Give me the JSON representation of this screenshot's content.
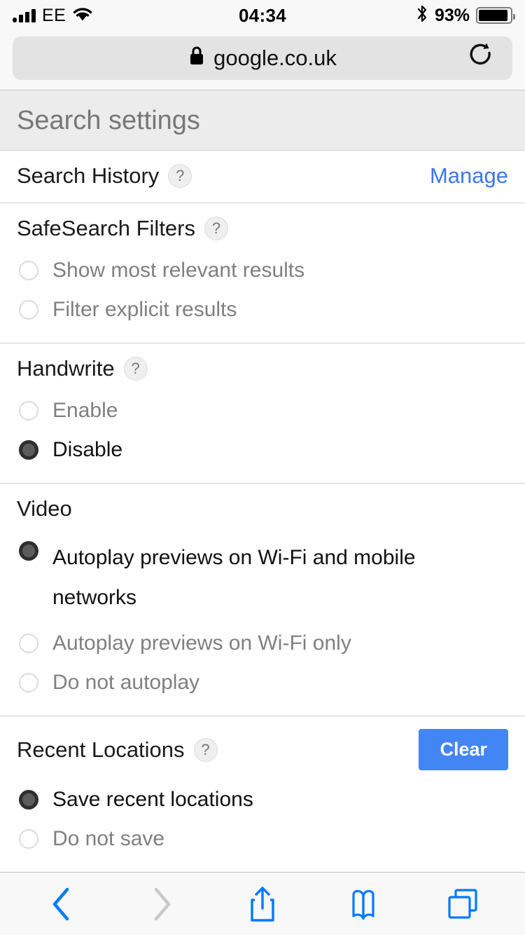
{
  "status_bar": {
    "carrier": "EE",
    "time": "04:34",
    "battery_percent": "93%",
    "signal_icon": "signal-bars-icon",
    "wifi_icon": "wifi-icon",
    "bluetooth_icon": "bluetooth-icon",
    "battery_icon": "battery-icon"
  },
  "browser": {
    "url": "google.co.uk",
    "lock_icon": "lock-icon",
    "reload_icon": "reload-icon",
    "toolbar": {
      "back_icon": "back-chevron-icon",
      "forward_icon": "forward-chevron-icon",
      "share_icon": "share-icon",
      "bookmarks_icon": "bookmarks-book-icon",
      "tabs_icon": "tabs-icon"
    }
  },
  "page": {
    "banner_title": "Search settings",
    "help_glyph": "?",
    "sections": [
      {
        "title": "Search History",
        "has_help": true,
        "action_label": "Manage",
        "action_type": "link",
        "options": []
      },
      {
        "title": "SafeSearch Filters",
        "has_help": true,
        "options": [
          {
            "label": "Show most relevant results",
            "selected": false
          },
          {
            "label": "Filter explicit results",
            "selected": false
          }
        ]
      },
      {
        "title": "Handwrite",
        "has_help": true,
        "options": [
          {
            "label": "Enable",
            "selected": false
          },
          {
            "label": "Disable",
            "selected": true
          }
        ]
      },
      {
        "title": "Video",
        "has_help": false,
        "options": [
          {
            "label": "Autoplay previews on Wi-Fi and mobile networks",
            "selected": true,
            "wraps": true
          },
          {
            "label": "Autoplay previews on Wi-Fi only",
            "selected": false
          },
          {
            "label": "Do not autoplay",
            "selected": false
          }
        ]
      },
      {
        "title": "Recent Locations",
        "has_help": true,
        "action_label": "Clear",
        "action_type": "button",
        "options": [
          {
            "label": "Save recent locations",
            "selected": true
          },
          {
            "label": "Do not save",
            "selected": false
          }
        ]
      }
    ]
  },
  "colors": {
    "accent_blue": "#4285f4",
    "link_blue": "#3b78e7",
    "ios_blue": "#007aff",
    "banner_bg": "#ececec"
  }
}
